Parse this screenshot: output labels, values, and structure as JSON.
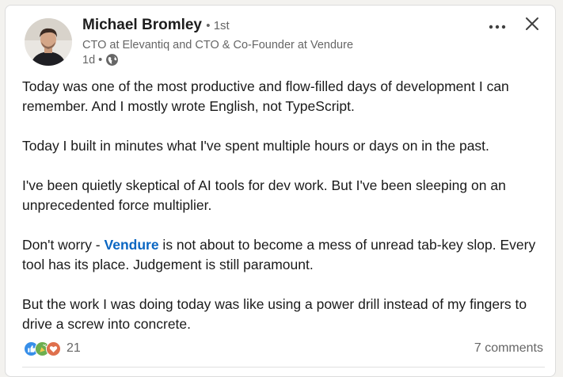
{
  "author": {
    "name": "Michael Bromley",
    "degree": "• 1st",
    "headline": "CTO at Elevantiq and CTO & Co-Founder at Vendure",
    "time": "1d",
    "separator": "•",
    "visibility_icon": "globe-icon"
  },
  "actions": {
    "more_icon": "ellipsis-icon",
    "close_icon": "close-icon"
  },
  "post": {
    "p1": "Today was one of the most productive and flow-filled days of development I can remember. And I mostly wrote English, not TypeScript.",
    "p2": "Today I built in minutes what I've spent multiple hours or days on in the past.",
    "p3": "I've been quietly skeptical of AI tools for dev work. But I've been sleeping on an unprecedented force multiplier.",
    "p4_before": "Don't worry - ",
    "p4_mention": "Vendure",
    "p4_after": " is not about to become a mess of unread tab-key slop. Every tool has its place. Judgement is still paramount.",
    "p5": "But the work I was doing today was like using a power drill instead of my fingers to drive a screw into concrete."
  },
  "social": {
    "reaction_icons": [
      "like-icon",
      "celebrate-icon",
      "love-icon"
    ],
    "reaction_count": "21",
    "comments": "7 comments"
  },
  "colors": {
    "link": "#0a66c2",
    "like": "#378fe9",
    "celebrate": "#6dae4f",
    "love": "#df704d",
    "muted_text": "#666666"
  }
}
